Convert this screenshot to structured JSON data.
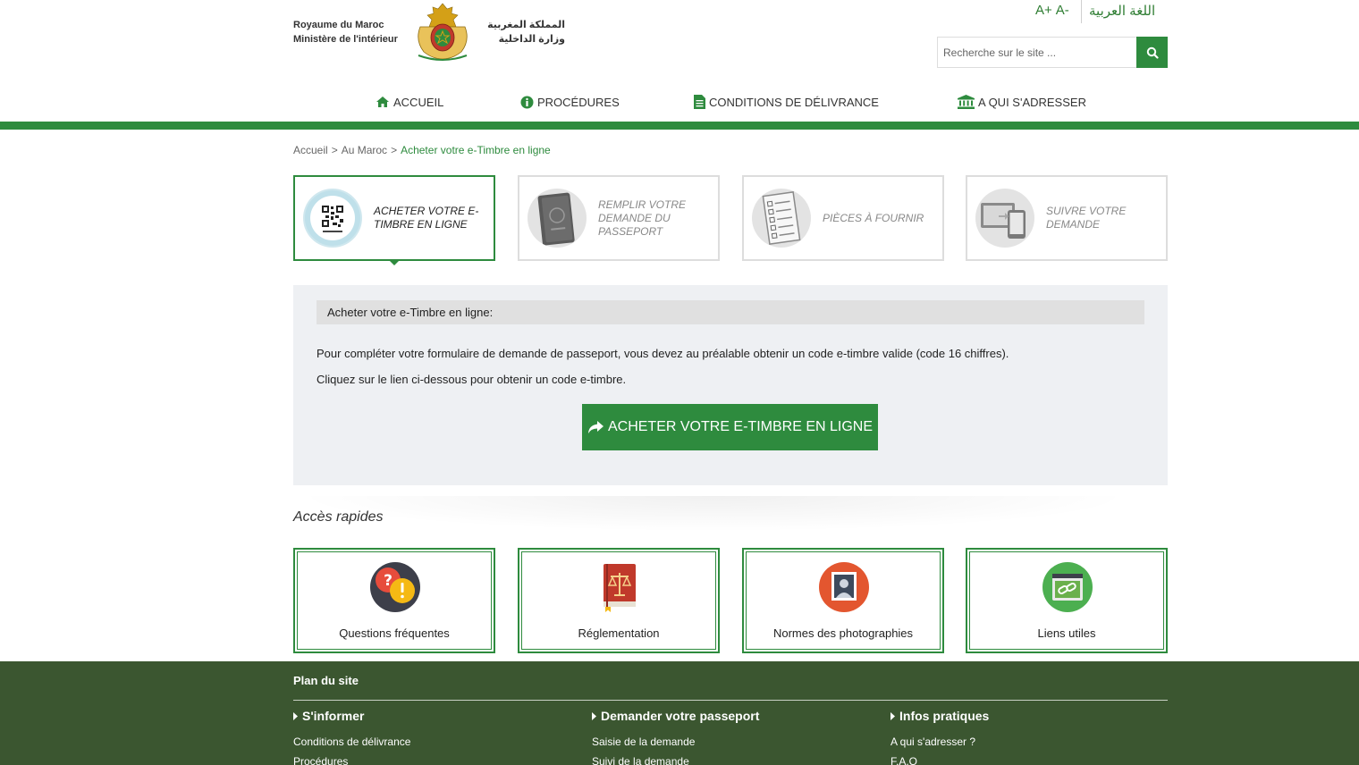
{
  "header": {
    "brand_fr_line1": "Royaume du Maroc",
    "brand_fr_line2": "Ministère de l'intérieur",
    "brand_ar_line1": "المملكة المغربية",
    "brand_ar_line2": "وزارة الداخلية",
    "font_increase": "A+",
    "font_decrease": "A-",
    "language_link": "اللغة العربية",
    "search_placeholder": "Recherche sur le site ..."
  },
  "nav": {
    "items": [
      {
        "label": "Accueil",
        "icon": "home-icon"
      },
      {
        "label": "Procédures",
        "icon": "info-icon"
      },
      {
        "label": "Conditions de délivrance",
        "icon": "document-icon"
      },
      {
        "label": "A qui s'adresser",
        "icon": "institution-icon"
      }
    ]
  },
  "breadcrumb": {
    "items": [
      "Accueil",
      "Au Maroc",
      "Acheter votre e-Timbre en ligne"
    ],
    "separator": ">"
  },
  "steps": [
    {
      "label": "Acheter votre e-Timbre en ligne",
      "icon": "qr-stamp-icon",
      "active": true
    },
    {
      "label": "Remplir votre demande du passeport",
      "icon": "passport-icon",
      "active": false
    },
    {
      "label": "Pièces à fournir",
      "icon": "checklist-icon",
      "active": false
    },
    {
      "label": "Suivre votre demande",
      "icon": "devices-icon",
      "active": false
    }
  ],
  "panel": {
    "title": "Acheter votre e-Timbre en ligne:",
    "text1": "Pour compléter votre formulaire de demande de passeport, vous devez au préalable obtenir un code e-timbre valide (code 16 chiffres).",
    "text2": "Cliquez sur le lien ci-dessous pour obtenir un code e-timbre.",
    "button_label": "Acheter votre e-Timbre en ligne"
  },
  "quick_access": {
    "title": "Accès rapides",
    "cards": [
      {
        "label": "Questions fréquentes",
        "icon": "faq-icon"
      },
      {
        "label": "Réglementation",
        "icon": "law-book-icon"
      },
      {
        "label": "Normes des photographies",
        "icon": "photo-id-icon"
      },
      {
        "label": "Liens utiles",
        "icon": "link-icon"
      }
    ]
  },
  "footer": {
    "title": "Plan du site",
    "columns": [
      {
        "heading": "S'informer",
        "links": [
          "Conditions de délivrance",
          "Procédures"
        ]
      },
      {
        "heading": "Demander votre passeport",
        "links": [
          "Saisie de la demande",
          "Suivi de la demande"
        ]
      },
      {
        "heading": "Infos pratiques",
        "links": [
          "A qui s'adresser ?",
          "F.A.Q"
        ]
      }
    ]
  },
  "colors": {
    "primary_green": "#2e8b3e",
    "footer_green": "#3b5630",
    "panel_bg": "#eef0f3"
  }
}
